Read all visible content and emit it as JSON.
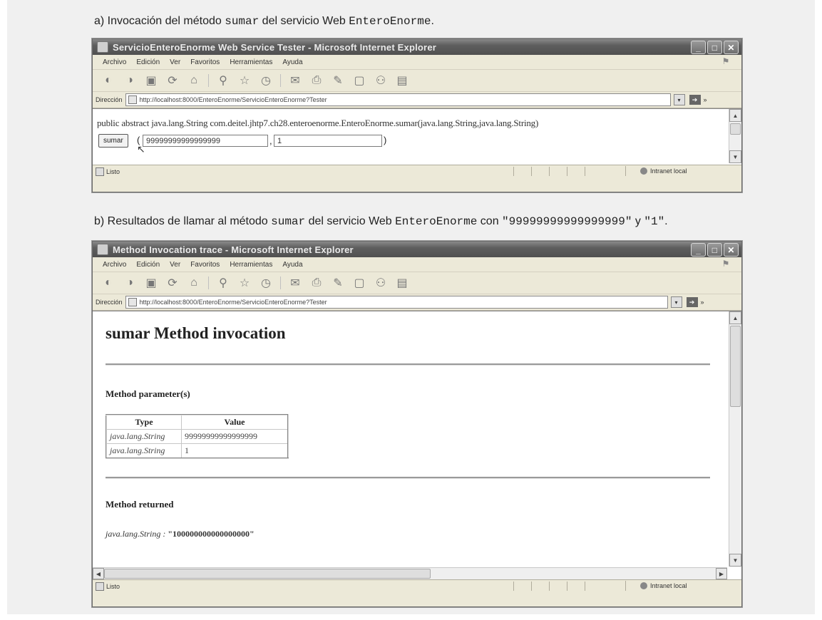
{
  "caption_a": {
    "prefix": "a) Invocación del método ",
    "method": "sumar",
    "middle": " del servicio Web ",
    "service": "EnteroEnorme",
    "suffix": "."
  },
  "caption_b": {
    "prefix": "b) Resultados de llamar al método ",
    "method": "sumar",
    "middle": " del servicio Web ",
    "service": "EnteroEnorme",
    "middle2": " con ",
    "arg1": "\"99999999999999999\"",
    "y": " y ",
    "arg2": "\"1\"",
    "suffix": "."
  },
  "window_a": {
    "title": "ServicioEnteroEnorme Web Service Tester - Microsoft Internet Explorer",
    "menu": [
      "Archivo",
      "Edición",
      "Ver",
      "Favoritos",
      "Herramientas",
      "Ayuda"
    ],
    "address_label": "Dirección",
    "address_url": "http://localhost:8000/EnteroEnorme/ServicioEnteroEnorme?Tester",
    "go_label": "Ir",
    "signature": "public abstract java.lang.String com.deitel.jhtp7.ch28.enteroenorme.EnteroEnorme.sumar(java.lang.String,java.lang.String)",
    "button_label": "sumar",
    "open_paren": "(",
    "input1_value": "99999999999999999",
    "comma": ",",
    "input2_value": "1",
    "close_paren": ")",
    "status_text": "Listo",
    "zone_text": "Intranet local"
  },
  "window_b": {
    "title": "Method Invocation trace - Microsoft Internet Explorer",
    "menu": [
      "Archivo",
      "Edición",
      "Ver",
      "Favoritos",
      "Herramientas",
      "Ayuda"
    ],
    "address_label": "Dirección",
    "address_url": "http://localhost:8000/EnteroEnorme/ServicioEnteroEnorme?Tester",
    "go_label": "Ir",
    "heading": "sumar Method invocation",
    "params_heading": "Method parameter(s)",
    "table_headers": [
      "Type",
      "Value"
    ],
    "table_rows": [
      [
        "java.lang.String",
        "99999999999999999"
      ],
      [
        "java.lang.String",
        "1"
      ]
    ],
    "returned_heading": "Method returned",
    "returned_type": "java.lang.String : ",
    "returned_value": "\"100000000000000000\"",
    "status_text": "Listo",
    "zone_text": "Intranet local"
  }
}
